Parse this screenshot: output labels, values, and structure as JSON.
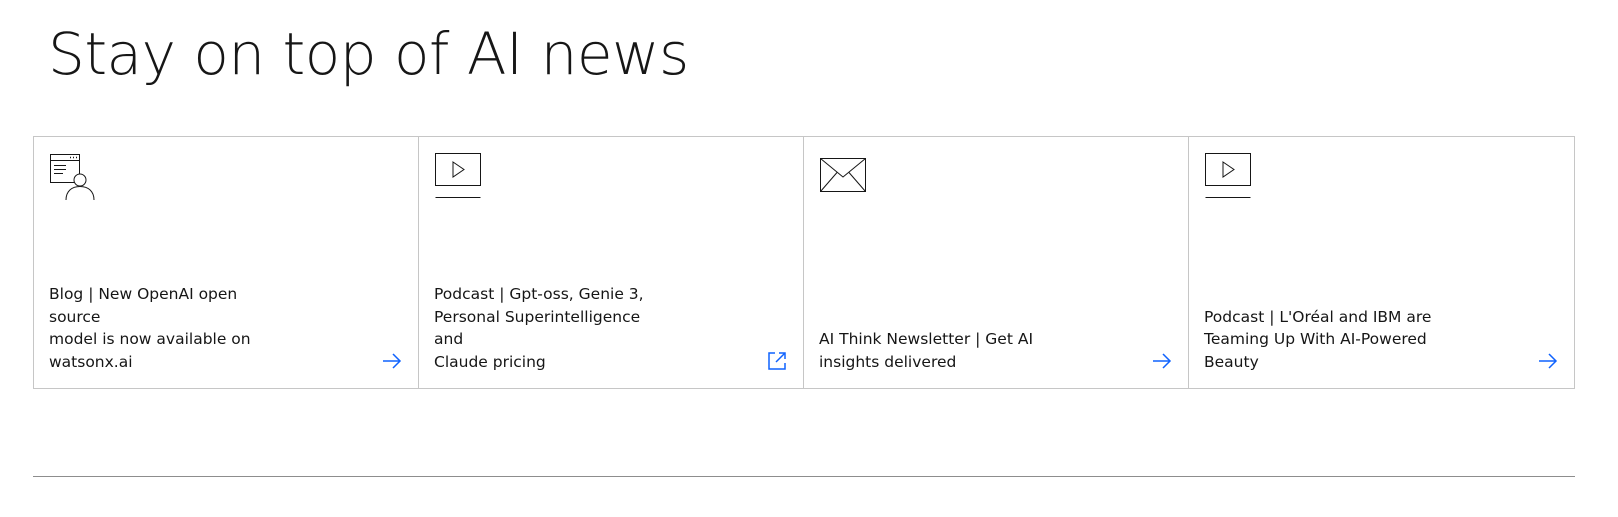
{
  "heading": "Stay on top of AI news",
  "accent_color": "#0f62fe",
  "cards": [
    {
      "icon": "blog-person-icon",
      "text": "Blog | New OpenAI open source\nmodel is now available on\nwatsonx.ai",
      "action_icon": "arrow-right-icon"
    },
    {
      "icon": "video-play-icon",
      "text": "Podcast | Gpt-oss, Genie 3,\nPersonal Superintelligence and\nClaude pricing",
      "action_icon": "external-link-icon"
    },
    {
      "icon": "envelope-icon",
      "text": "AI Think Newsletter | Get AI\ninsights delivered",
      "action_icon": "arrow-right-icon"
    },
    {
      "icon": "video-play-icon",
      "text": "Podcast | L'Oréal and IBM are\nTeaming Up With AI-Powered\nBeauty",
      "action_icon": "arrow-right-icon"
    }
  ]
}
